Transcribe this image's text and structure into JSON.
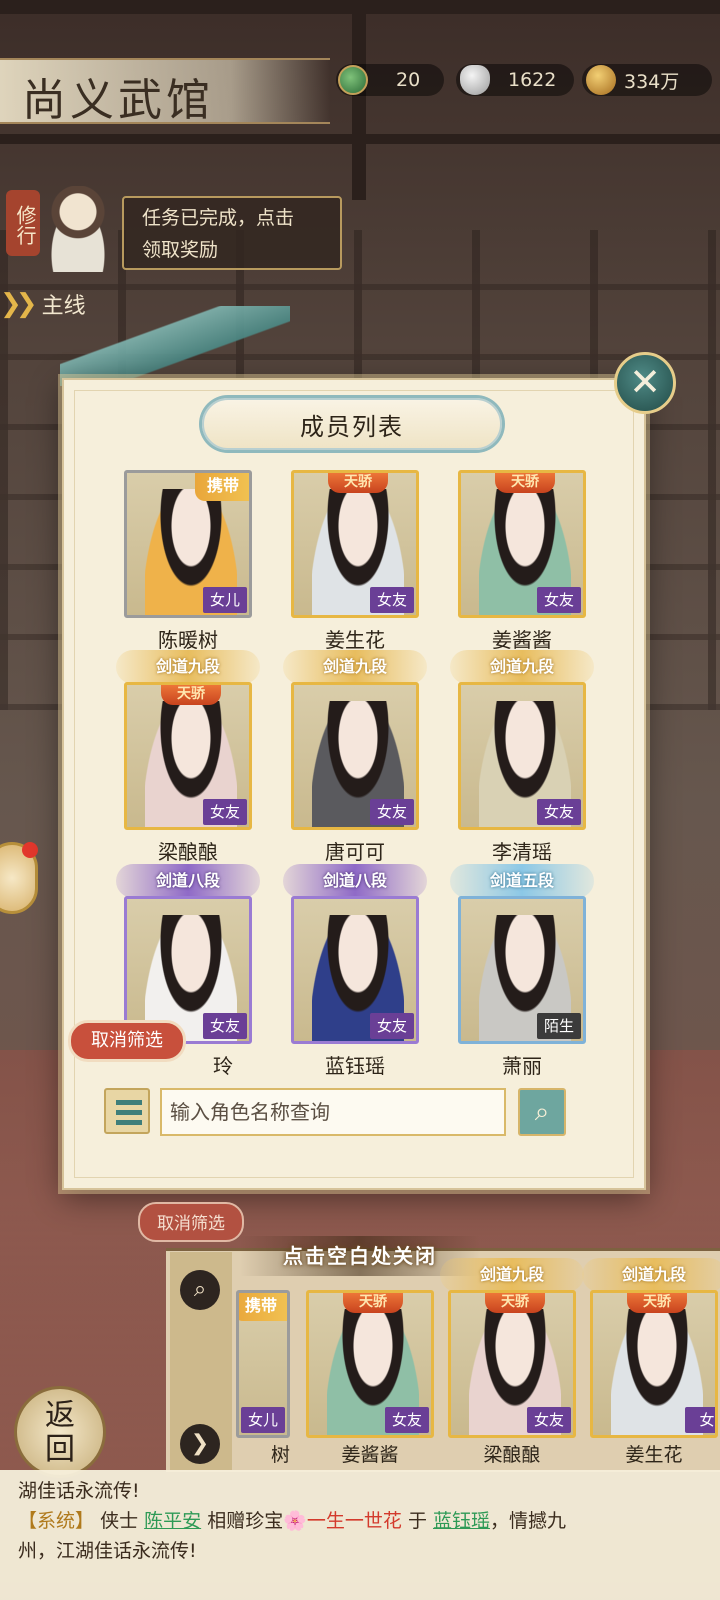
{
  "header": {
    "title": "尚义武馆",
    "currency": [
      {
        "icon": "dragon-token-icon",
        "value": "20"
      },
      {
        "icon": "silver-ingot-icon",
        "value": "1622"
      },
      {
        "icon": "copper-coins-icon",
        "value": "334万"
      }
    ]
  },
  "quest": {
    "tag": "修行",
    "message_line1": "任务已完成，点击",
    "message_line2": "领取奖励",
    "mainline": "主线"
  },
  "modal": {
    "title": "成员列表",
    "close_icon": "close-x-icon",
    "members": [
      {
        "name": "陈暖树",
        "relation": "女儿",
        "tag": "携带",
        "rank": "",
        "frame": "gray"
      },
      {
        "name": "姜生花",
        "relation": "女友",
        "tag": "天骄",
        "rank": "",
        "frame": "gold"
      },
      {
        "name": "姜酱酱",
        "relation": "女友",
        "tag": "天骄",
        "rank": "",
        "frame": "gold"
      },
      {
        "name": "梁酿酿",
        "relation": "女友",
        "tag": "天骄",
        "rank": "剑道九段",
        "frame": "gold"
      },
      {
        "name": "唐可可",
        "relation": "女友",
        "tag": "",
        "rank": "剑道九段",
        "frame": "gold"
      },
      {
        "name": "李清瑶",
        "relation": "女友",
        "tag": "",
        "rank": "剑道九段",
        "frame": "gold"
      },
      {
        "name": "玲",
        "relation": "女友",
        "tag": "",
        "rank": "剑道八段",
        "frame": "purple"
      },
      {
        "name": "蓝钰瑶",
        "relation": "女友",
        "tag": "",
        "rank": "剑道八段",
        "frame": "purple"
      },
      {
        "name": "萧丽",
        "relation": "陌生",
        "tag": "",
        "rank": "剑道五段",
        "frame": "blue"
      }
    ],
    "cancel_filter": "取消筛选",
    "search_placeholder": "输入角色名称查询"
  },
  "background": {
    "cancel_filter": "取消筛选",
    "tap_to_close": "点击空白处关闭",
    "strip": [
      {
        "name": "树",
        "relation": "女儿",
        "tag": "携带",
        "rank": ""
      },
      {
        "name": "姜酱酱",
        "relation": "女友",
        "tag": "天骄",
        "rank": ""
      },
      {
        "name": "梁酿酿",
        "relation": "女友",
        "tag": "天骄",
        "rank": "剑道九段"
      },
      {
        "name": "姜生花",
        "relation": "女",
        "tag": "天骄",
        "rank": "剑道九段"
      }
    ],
    "back_label": "返回"
  },
  "chat": {
    "line1": "湖佳话永流传!",
    "sys_label": "【系统】",
    "hero_prefix": "侠士",
    "giver": "陈平安",
    "gift_verb": "相赠珍宝",
    "gift": "一生一世花",
    "to": "于",
    "receiver": "蓝钰瑶",
    "line2_tail": "，情撼九",
    "line3": "州，江湖佳话永流传!"
  },
  "colors": {
    "rel_purple": "#6a3f96",
    "gold_frame": "#e7b743",
    "accent_teal": "#4f8a86",
    "cancel_red": "#c8503c"
  }
}
